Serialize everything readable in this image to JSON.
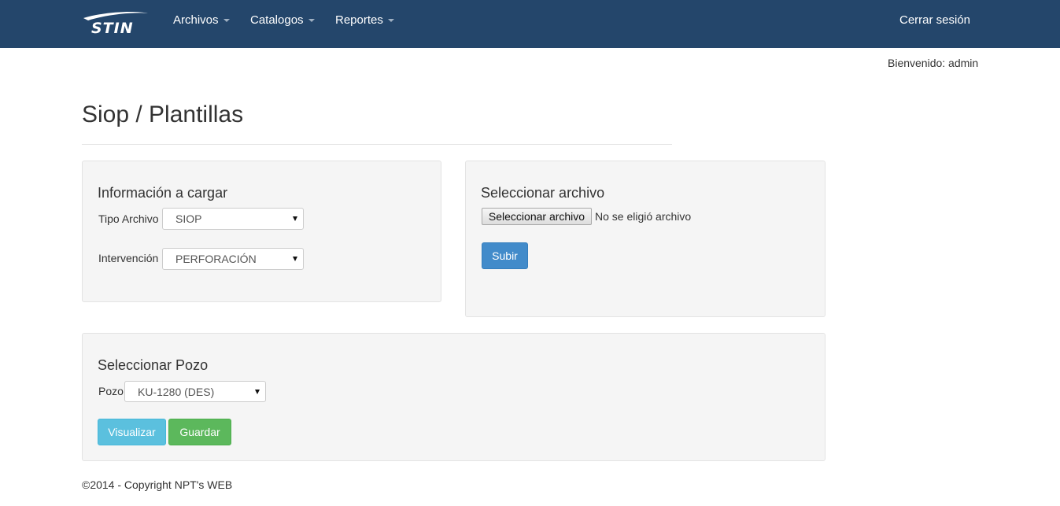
{
  "navbar": {
    "logo_text": "STIN",
    "menu": [
      {
        "label": "Archivos"
      },
      {
        "label": "Catalogos"
      },
      {
        "label": "Reportes"
      }
    ],
    "logout": "Cerrar sesión"
  },
  "welcome": "Bienvenido: admin",
  "page": {
    "title": "Siop / Plantillas"
  },
  "info_panel": {
    "title": "Información a cargar",
    "tipo_label": "Tipo Archivo",
    "tipo_value": "SIOP",
    "intervencion_label": "Intervención",
    "intervencion_value": "PERFORACIÓN"
  },
  "file_panel": {
    "title": "Seleccionar archivo",
    "choose_button": "Seleccionar archivo",
    "no_file": "No se eligió archivo",
    "submit": "Subir"
  },
  "pozo_panel": {
    "title": "Seleccionar Pozo",
    "pozo_label": "Pozo",
    "pozo_value": "KU-1280 (DES)",
    "visualizar": "Visualizar",
    "guardar": "Guardar"
  },
  "footer": {
    "copyright": "©2014 - Copyright NPT's WEB"
  },
  "colors": {
    "navbar_bg": "#24466b",
    "primary": "#428bca",
    "info": "#5bc0de",
    "success": "#5cb85c",
    "panel_bg": "#f5f5f5"
  }
}
